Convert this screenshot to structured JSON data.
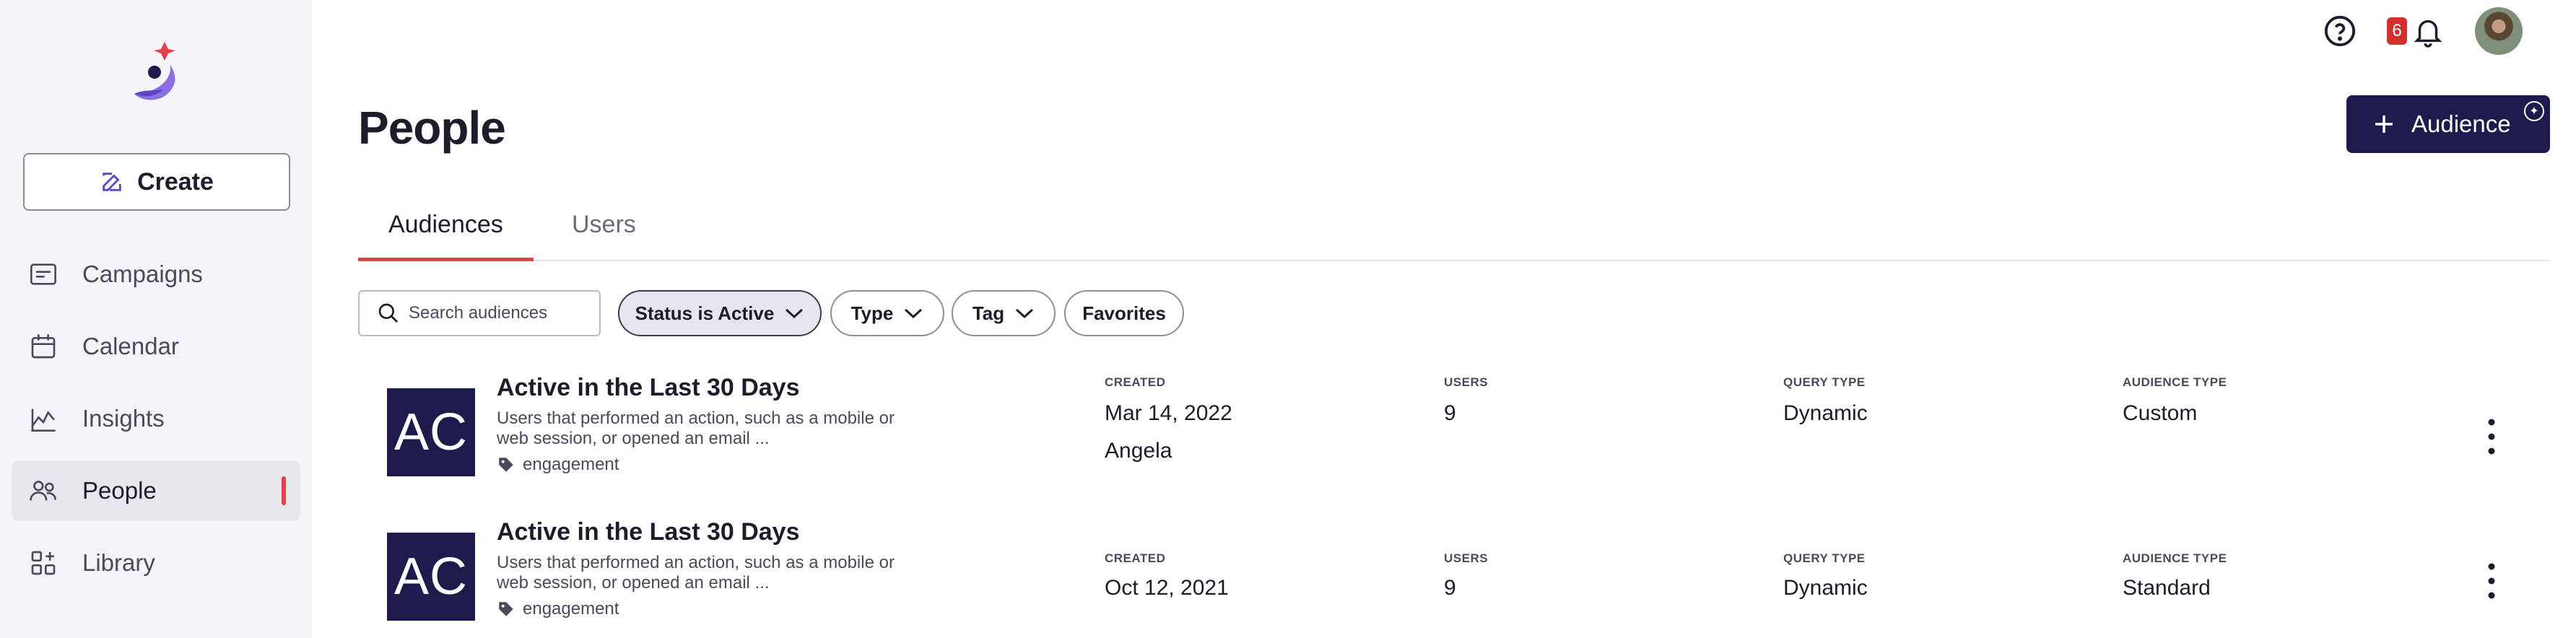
{
  "sidebar": {
    "create_label": "Create",
    "items": [
      {
        "label": "Campaigns",
        "icon": "campaigns-icon",
        "active": false
      },
      {
        "label": "Calendar",
        "icon": "calendar-icon",
        "active": false
      },
      {
        "label": "Insights",
        "icon": "insights-icon",
        "active": false
      },
      {
        "label": "People",
        "icon": "people-icon",
        "active": true
      },
      {
        "label": "Library",
        "icon": "library-icon",
        "active": false
      }
    ]
  },
  "header": {
    "notification_count": "6",
    "title": "People",
    "audience_button_label": "Audience"
  },
  "tabs": [
    {
      "label": "Audiences",
      "active": true
    },
    {
      "label": "Users",
      "active": false
    }
  ],
  "filters": {
    "search_placeholder": "Search audiences",
    "status_label": "Status is Active",
    "type_label": "Type",
    "tag_label": "Tag",
    "favorites_label": "Favorites"
  },
  "columns": {
    "created": "CREATED",
    "users": "USERS",
    "query_type": "QUERY TYPE",
    "audience_type": "AUDIENCE TYPE"
  },
  "rows": [
    {
      "initials": "AC",
      "title": "Active in the Last 30 Days",
      "description": "Users that performed an action, such as a mobile or web session, or opened an email ...",
      "tag": "engagement",
      "created": "Mar 14, 2022",
      "created_by": "Angela",
      "users": "9",
      "query_type": "Dynamic",
      "audience_type": "Custom"
    },
    {
      "initials": "AC",
      "title": "Active in the Last 30 Days",
      "description": "Users that performed an action, such as a mobile or web session, or opened an email ...",
      "tag": "engagement",
      "created": "Oct 12, 2021",
      "created_by": "",
      "users": "9",
      "query_type": "Dynamic",
      "audience_type": "Standard"
    }
  ],
  "colors": {
    "accent": "#e5414b",
    "primary": "#1d1b4c",
    "sidebar_bg": "#f5f4f8"
  }
}
